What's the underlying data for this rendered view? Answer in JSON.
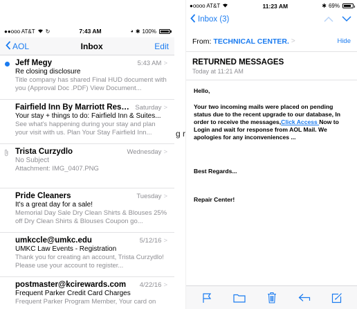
{
  "left_phone": {
    "status": {
      "carrier": "●●ooo AT&T",
      "time": "7:43 AM",
      "battery": "100%"
    },
    "nav": {
      "back_label": "AOL",
      "title": "Inbox",
      "edit_label": "Edit"
    },
    "messages": [
      {
        "from": "Jeff Megy",
        "date": "5:43 AM",
        "subject": "Re closing disclosure",
        "preview": "Title company has shared Final HUD document with you (Approval Doc .PDF) View Document...",
        "unread": true,
        "attachment": false
      },
      {
        "from": "Fairfield Inn By Marriott Rese...",
        "date": "Saturday",
        "subject": "Your stay + things to do: Fairfield Inn & Suites...",
        "preview": "See what's happening during your stay and plan your visit with us. Plan Your Stay Fairfield Inn...",
        "unread": false,
        "attachment": false
      },
      {
        "from": "Trista Curzydlo",
        "date": "Wednesday",
        "subject": "No Subject",
        "preview": "Attachment: IMG_0407.PNG",
        "unread": false,
        "attachment": true
      },
      {
        "from": "Pride Cleaners",
        "date": "Tuesday",
        "subject": "It's a great day for a sale!",
        "preview": "Memorial Day Sale Dry Clean Shirts & Blouses 25% off Dry Clean Shirts & Blouses Coupon go...",
        "unread": false,
        "attachment": false
      },
      {
        "from": "umkccle@umkc.edu",
        "date": "5/12/16",
        "subject": "UMKC Law Events - Registration",
        "preview": "Thank you for creating an account, Trista Curzydlo! Please use your account to register...",
        "unread": false,
        "attachment": false
      },
      {
        "from": "postmaster@kcirewards.com",
        "date": "4/22/16",
        "subject": "Frequent Parker Credit Card Charges",
        "preview": "Frequent Parker Program Member, Your card on",
        "unread": false,
        "attachment": false
      }
    ]
  },
  "gap_text": "g r",
  "right_phone": {
    "status": {
      "carrier": "●oooo AT&T",
      "time": "11:23 AM",
      "battery": "69%"
    },
    "nav": {
      "back_label": "Inbox (3)"
    },
    "from_label": "From:",
    "from_name": "TECHNICAL CENTER.",
    "hide_label": "Hide",
    "subject": "RETURNED MESSAGES",
    "time": "Today at 11:21 AM",
    "body": {
      "greeting": "Hello,",
      "para_part1": "Your two incoming mails were placed on pending status due to the recent upgrade to our database, In order to receive the messages,",
      "link_text": "Click Access ",
      "para_part2": "Now to Login and wait for response from AOL Mail. We apologies for any inconveniences ...",
      "regards": "Best Regards...",
      "signature": "Repair Center!"
    }
  },
  "colors": {
    "accent": "#1a7bf0",
    "muted": "#8e8e93"
  }
}
